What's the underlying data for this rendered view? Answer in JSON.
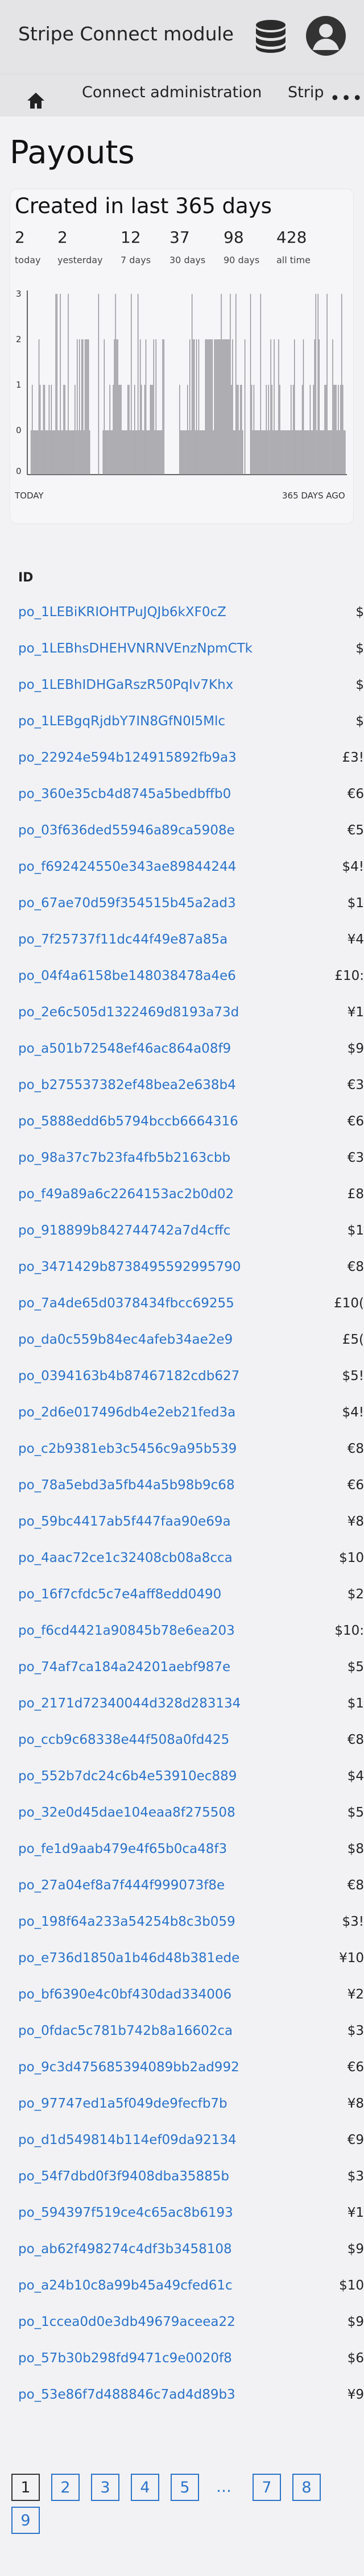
{
  "app": {
    "title": "Stripe Connect module"
  },
  "nav": {
    "admin_label": "Connect administration",
    "strip_label": "Strip",
    "more_label": "•••"
  },
  "page": {
    "title": "Payouts"
  },
  "summary": {
    "title": "Created in last 365 days",
    "stats": [
      {
        "value": "2",
        "label": "today"
      },
      {
        "value": "2",
        "label": "yesterday"
      },
      {
        "value": "12",
        "label": "7 days"
      },
      {
        "value": "37",
        "label": "30 days"
      },
      {
        "value": "98",
        "label": "90 days"
      },
      {
        "value": "428",
        "label": "all time"
      }
    ],
    "chart_data": {
      "type": "bar",
      "y_ticks": [
        "3",
        "2",
        "1",
        "0",
        "0"
      ],
      "x_left_label": "TODAY",
      "x_right_label": "365 DAYS AGO"
    }
  },
  "table": {
    "id_header": "ID",
    "rows": [
      {
        "id": "po_1LEBiKRIOHTPuJQJb6kXF0cZ",
        "amount": "$"
      },
      {
        "id": "po_1LEBhsDHEHVNRNVEnzNpmCTk",
        "amount": "$"
      },
      {
        "id": "po_1LEBhIDHGaRszR50PqIv7Khx",
        "amount": "$"
      },
      {
        "id": "po_1LEBgqRjdbY7IN8GfN0I5Mlc",
        "amount": "$"
      },
      {
        "id": "po_22924e594b124915892fb9a3",
        "amount": "£3!"
      },
      {
        "id": "po_360e35cb4d8745a5bedbffb0",
        "amount": "€6"
      },
      {
        "id": "po_03f636ded55946a89ca5908e",
        "amount": "€5"
      },
      {
        "id": "po_f692424550e343ae89844244",
        "amount": "$4!"
      },
      {
        "id": "po_67ae70d59f354515b45a2ad3",
        "amount": "$1"
      },
      {
        "id": "po_7f25737f11dc44f49e87a85a",
        "amount": "¥4"
      },
      {
        "id": "po_04f4a6158be148038478a4e6",
        "amount": "£10:"
      },
      {
        "id": "po_2e6c505d1322469d8193a73d",
        "amount": "¥1"
      },
      {
        "id": "po_a501b72548ef46ac864a08f9",
        "amount": "$9"
      },
      {
        "id": "po_b275537382ef48bea2e638b4",
        "amount": "€3"
      },
      {
        "id": "po_5888edd6b5794bccb6664316",
        "amount": "€6"
      },
      {
        "id": "po_98a37c7b23fa4fb5b2163cbb",
        "amount": "€3"
      },
      {
        "id": "po_f49a89a6c2264153ac2b0d02",
        "amount": "£8"
      },
      {
        "id": "po_918899b842744742a7d4cffc",
        "amount": "$1"
      },
      {
        "id": "po_3471429b8738495592995790",
        "amount": "€8"
      },
      {
        "id": "po_7a4de65d0378434fbcc69255",
        "amount": "£10("
      },
      {
        "id": "po_da0c559b84ec4afeb34ae2e9",
        "amount": "£5("
      },
      {
        "id": "po_0394163b4b87467182cdb627",
        "amount": "$5!"
      },
      {
        "id": "po_2d6e017496db4e2eb21fed3a",
        "amount": "$4!"
      },
      {
        "id": "po_c2b9381eb3c5456c9a95b539",
        "amount": "€8"
      },
      {
        "id": "po_78a5ebd3a5fb44a5b98b9c68",
        "amount": "€6"
      },
      {
        "id": "po_59bc4417ab5f447faa90e69a",
        "amount": "¥8"
      },
      {
        "id": "po_4aac72ce1c32408cb08a8cca",
        "amount": "$10"
      },
      {
        "id": "po_16f7cfdc5c7e4aff8edd0490",
        "amount": "$2"
      },
      {
        "id": "po_f6cd4421a90845b78e6ea203",
        "amount": "$10:"
      },
      {
        "id": "po_74af7ca184a24201aebf987e",
        "amount": "$5"
      },
      {
        "id": "po_2171d72340044d328d283134",
        "amount": "$1"
      },
      {
        "id": "po_ccb9c68338e44f508a0fd425",
        "amount": "€8"
      },
      {
        "id": "po_552b7dc24c6b4e53910ec889",
        "amount": "$4"
      },
      {
        "id": "po_32e0d45dae104eaa8f275508",
        "amount": "$5"
      },
      {
        "id": "po_fe1d9aab479e4f65b0ca48f3",
        "amount": "$8"
      },
      {
        "id": "po_27a04ef8a7f444f999073f8e",
        "amount": "€8"
      },
      {
        "id": "po_198f64a233a54254b8c3b059",
        "amount": "$3!"
      },
      {
        "id": "po_e736d1850a1b46d48b381ede",
        "amount": "¥10"
      },
      {
        "id": "po_bf6390e4c0bf430dad334006",
        "amount": "¥2"
      },
      {
        "id": "po_0fdac5c781b742b8a16602ca",
        "amount": "$3"
      },
      {
        "id": "po_9c3d475685394089bb2ad992",
        "amount": "€6"
      },
      {
        "id": "po_97747ed1a5f049de9fecfb7b",
        "amount": "¥8"
      },
      {
        "id": "po_d1d549814b114ef09da92134",
        "amount": "€9"
      },
      {
        "id": "po_54f7dbd0f3f9408dba35885b",
        "amount": "$3"
      },
      {
        "id": "po_594397f519ce4c65ac8b6193",
        "amount": "¥1"
      },
      {
        "id": "po_ab62f498274c4df3b3458108",
        "amount": "$9"
      },
      {
        "id": "po_a24b10c8a99b45a49cfed61c",
        "amount": "$10"
      },
      {
        "id": "po_1ccea0d0e3db49679aceea22",
        "amount": "$9"
      },
      {
        "id": "po_57b30b298fd9471c9e0020f8",
        "amount": "$6"
      },
      {
        "id": "po_53e86f7d488846c7ad4d89b3",
        "amount": "¥9"
      }
    ]
  },
  "pagination": {
    "pages": [
      "1",
      "2",
      "3",
      "4",
      "5",
      "7",
      "8",
      "9"
    ],
    "current": "1",
    "ellipsis": "…"
  }
}
